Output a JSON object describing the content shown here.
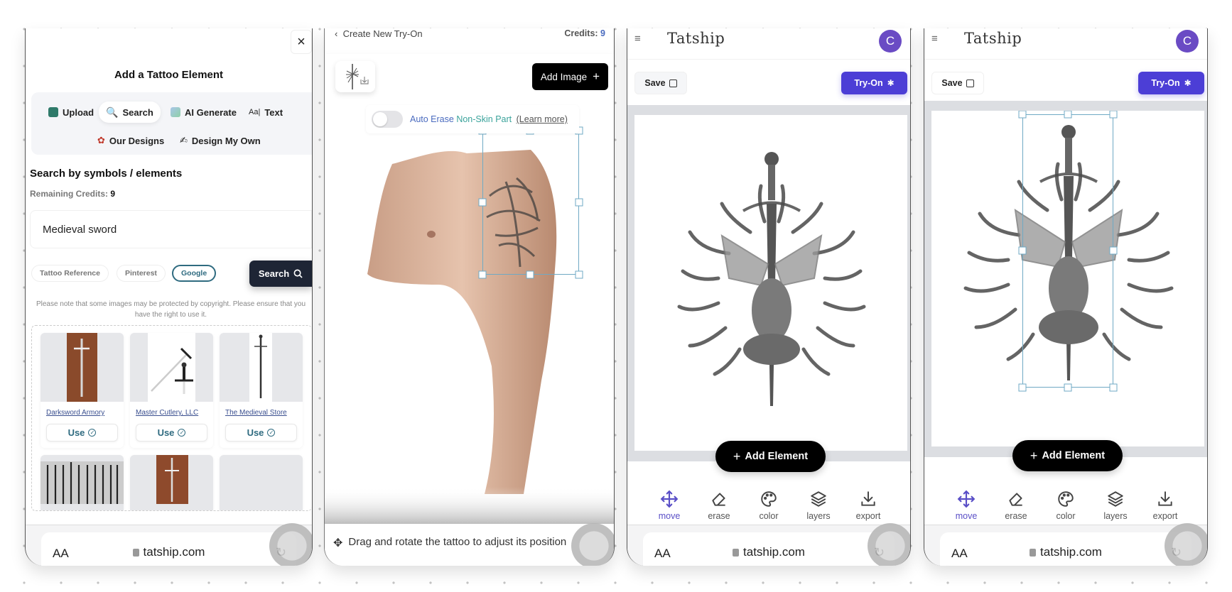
{
  "browser": {
    "aa_label": "AA",
    "url": "tatship.com"
  },
  "panel1": {
    "close_icon": "×",
    "title": "Add a Tattoo Element",
    "tabs": [
      {
        "label": "Upload",
        "icon": "image-upload-icon"
      },
      {
        "label": "Search",
        "icon": "magnifier-icon",
        "active": true
      },
      {
        "label": "AI Generate",
        "icon": "ai-generate-icon"
      },
      {
        "label": "Text",
        "icon": "text-icon"
      },
      {
        "label": "Our Designs",
        "icon": "rose-icon"
      },
      {
        "label": "Design My Own",
        "icon": "hand-drawing-icon"
      }
    ],
    "section_heading": "Search by symbols / elements",
    "credits_label": "Remaining Credits:",
    "credits_value": "9",
    "search_value": "Medieval sword",
    "sources": [
      {
        "label": "Tattoo Reference",
        "active": false
      },
      {
        "label": "Pinterest",
        "active": false
      },
      {
        "label": "Google",
        "active": true
      }
    ],
    "search_button": "Search",
    "notice": "Please note that some images may be protected by copyright. Please ensure that you have the right to use it.",
    "results": [
      {
        "source": "Darksword Armory",
        "use_label": "Use"
      },
      {
        "source": "Master Cutlery, LLC",
        "use_label": "Use"
      },
      {
        "source": "The Medieval Store",
        "use_label": "Use"
      },
      {
        "source": "",
        "use_label": ""
      },
      {
        "source": "",
        "use_label": ""
      },
      {
        "source": "",
        "use_label": ""
      }
    ]
  },
  "panel2": {
    "back_label": "Create New Try-On",
    "credits_label": "Credits:",
    "credits_value": "9",
    "add_image_label": "Add Image",
    "auto_erase_part1": "Auto Erase",
    "auto_erase_part2": "Non-Skin Part",
    "learn_more": "(Learn more)",
    "auto_erase_enabled": false,
    "hint": "Drag and rotate the tattoo to adjust its position"
  },
  "editor": {
    "logo": "Tatship",
    "avatar_initial": "C",
    "save_label": "Save",
    "tryon_label": "Try-On",
    "add_element_label": "Add Element",
    "tools": [
      {
        "label": "move",
        "icon": "move-icon",
        "active": true
      },
      {
        "label": "erase",
        "icon": "eraser-icon",
        "active": false
      },
      {
        "label": "color",
        "icon": "palette-icon",
        "active": false
      },
      {
        "label": "layers",
        "icon": "layers-icon",
        "active": false
      },
      {
        "label": "export",
        "icon": "download-icon",
        "active": false
      }
    ]
  },
  "colors": {
    "accent_purple": "#4c3ed6",
    "avatar_purple": "#6a4bc4",
    "source_chip_active": "#2f6b80",
    "search_button": "#1e2535",
    "selection_box": "#6fa9c4"
  }
}
